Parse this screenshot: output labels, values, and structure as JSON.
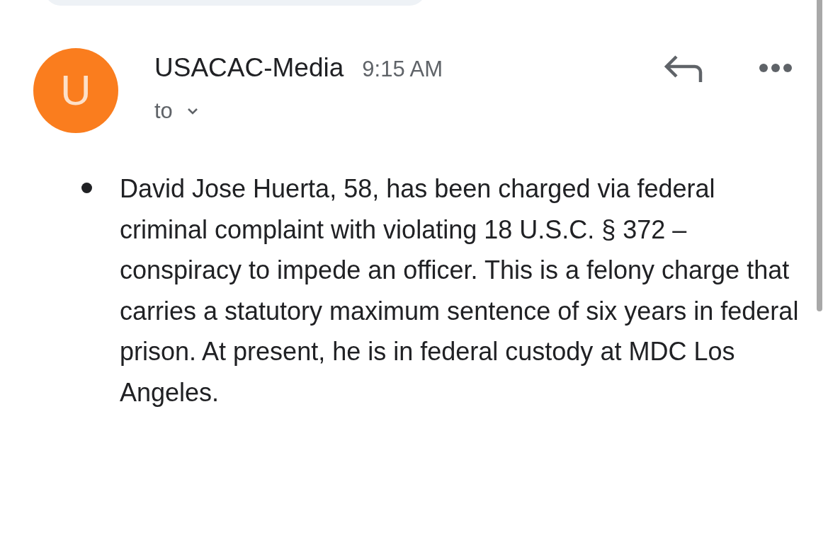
{
  "message": {
    "avatar_letter": "U",
    "sender": "USACAC-Media",
    "time": "9:15 AM",
    "recipient_label": "to",
    "body_items": [
      "David Jose Huerta, 58, has been charged via federal criminal complaint with violating 18 U.S.C. § 372 – conspiracy to impede an officer. This is a felony charge that carries a statutory maximum sentence of six years in federal prison. At present, he is in federal custody at MDC Los Angeles."
    ]
  }
}
